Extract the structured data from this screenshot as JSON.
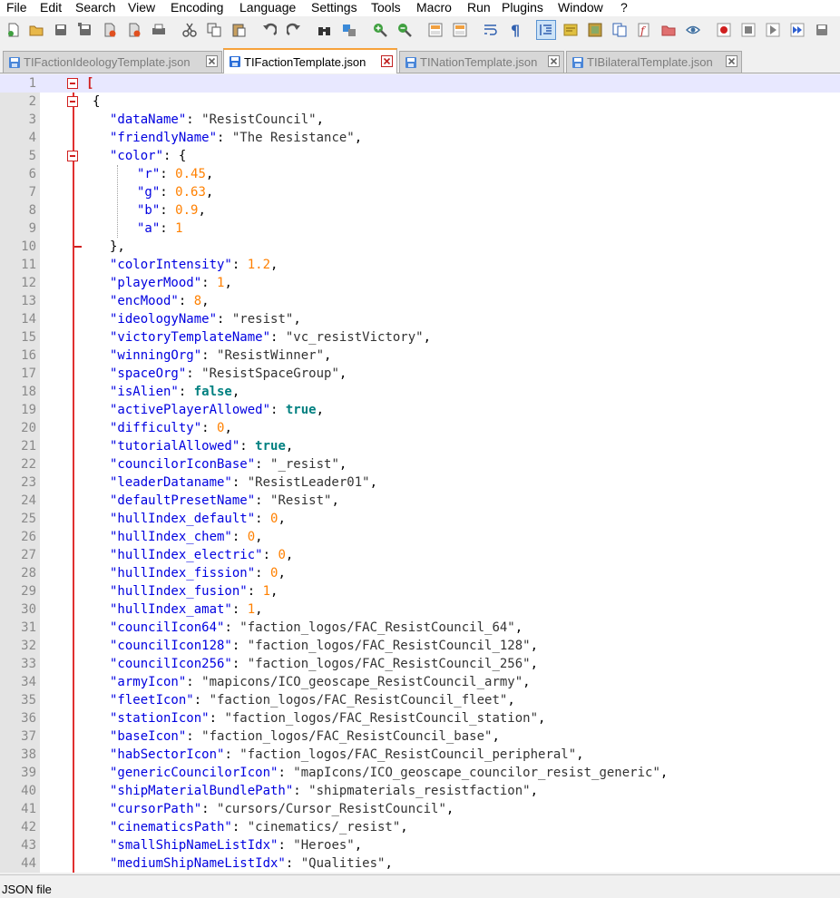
{
  "window": {
    "status_text": "JSON file"
  },
  "menu": [
    "File",
    "Edit",
    "Search",
    "View",
    "Encoding",
    "Language",
    "Settings",
    "Tools",
    "Macro",
    "Run",
    "Plugins",
    "Window",
    "?"
  ],
  "toolbar": {
    "buttons": [
      {
        "icon": "new-file-icon",
        "color": "#ffffff"
      },
      {
        "icon": "open-folder-icon",
        "color": "#e8b84a"
      },
      {
        "icon": "save-icon",
        "color": "#6a6a6a"
      },
      {
        "icon": "save-all-icon",
        "color": "#6a6a6a"
      },
      {
        "icon": "close-file-icon",
        "color": "#6a6a6a"
      },
      {
        "icon": "close-all-icon",
        "color": "#6a6a6a"
      },
      {
        "icon": "print-icon",
        "color": "#6a6a6a"
      },
      {
        "icon": "cut-icon",
        "color": "#555555"
      },
      {
        "icon": "copy-icon",
        "color": "#555555"
      },
      {
        "icon": "paste-icon",
        "color": "#555555"
      },
      {
        "icon": "undo-icon",
        "color": "#555555"
      },
      {
        "icon": "redo-icon",
        "color": "#555555"
      },
      {
        "icon": "find-icon",
        "color": "#333333"
      },
      {
        "icon": "replace-icon",
        "color": "#3b8ad8"
      },
      {
        "icon": "zoom-in-icon",
        "color": "#40a040"
      },
      {
        "icon": "zoom-out-icon",
        "color": "#40a040"
      },
      {
        "icon": "sync-vertical-icon",
        "color": "#f0a040"
      },
      {
        "icon": "sync-horizontal-icon",
        "color": "#f0a040"
      },
      {
        "icon": "word-wrap-icon",
        "color": "#3060b0"
      },
      {
        "icon": "show-all-characters-icon",
        "color": "#3060b0"
      },
      {
        "icon": "indent-guide-icon",
        "color": "#3060b0",
        "active": true
      },
      {
        "icon": "user-language-icon",
        "color": "#e0c040"
      },
      {
        "icon": "document-map-icon",
        "color": "#c0a040"
      },
      {
        "icon": "document-list-icon",
        "color": "#3060b0"
      },
      {
        "icon": "function-list-icon",
        "color": "#c03030"
      },
      {
        "icon": "folder-as-workspace-icon",
        "color": "#e07070"
      },
      {
        "icon": "monitoring-eye-icon",
        "color": "#4070a0"
      },
      {
        "icon": "record-macro-icon",
        "color": "#d02020"
      },
      {
        "icon": "stop-macro-icon",
        "color": "#808080"
      },
      {
        "icon": "play-macro-icon",
        "color": "#808080"
      },
      {
        "icon": "run-macro-multiple-icon",
        "color": "#3060d0"
      },
      {
        "icon": "save-macro-icon",
        "color": "#808080"
      }
    ]
  },
  "tabs": [
    {
      "label": "TIFactionIdeologyTemplate.json",
      "active": false
    },
    {
      "label": "TIFactionTemplate.json",
      "active": true
    },
    {
      "label": "TINationTemplate.json",
      "active": false
    },
    {
      "label": "TIBilateralTemplate.json",
      "active": false
    }
  ],
  "editor": {
    "current_line": 1,
    "lines": [
      {
        "n": "1",
        "indent": 0,
        "tokens": [
          [
            "bk",
            "["
          ]
        ]
      },
      {
        "n": "2",
        "indent": 1,
        "tokens": [
          [
            "p",
            "{"
          ]
        ]
      },
      {
        "n": "3",
        "indent": 2,
        "tokens": [
          [
            "k",
            "\"dataName\""
          ],
          [
            "p",
            ": "
          ],
          [
            "s",
            "\"ResistCouncil\""
          ],
          [
            "p",
            ","
          ]
        ]
      },
      {
        "n": "4",
        "indent": 2,
        "tokens": [
          [
            "k",
            "\"friendlyName\""
          ],
          [
            "p",
            ": "
          ],
          [
            "s",
            "\"The Resistance\""
          ],
          [
            "p",
            ","
          ]
        ]
      },
      {
        "n": "5",
        "indent": 2,
        "tokens": [
          [
            "k",
            "\"color\""
          ],
          [
            "p",
            ": {"
          ]
        ]
      },
      {
        "n": "6",
        "indent": 3,
        "tokens": [
          [
            "k",
            "\"r\""
          ],
          [
            "p",
            ": "
          ],
          [
            "n",
            "0.45"
          ],
          [
            "p",
            ","
          ]
        ]
      },
      {
        "n": "7",
        "indent": 3,
        "tokens": [
          [
            "k",
            "\"g\""
          ],
          [
            "p",
            ": "
          ],
          [
            "n",
            "0.63"
          ],
          [
            "p",
            ","
          ]
        ]
      },
      {
        "n": "8",
        "indent": 3,
        "tokens": [
          [
            "k",
            "\"b\""
          ],
          [
            "p",
            ": "
          ],
          [
            "n",
            "0.9"
          ],
          [
            "p",
            ","
          ]
        ]
      },
      {
        "n": "9",
        "indent": 3,
        "tokens": [
          [
            "k",
            "\"a\""
          ],
          [
            "p",
            ": "
          ],
          [
            "n",
            "1"
          ]
        ]
      },
      {
        "n": "10",
        "indent": 2,
        "tokens": [
          [
            "p",
            "},"
          ]
        ]
      },
      {
        "n": "11",
        "indent": 2,
        "tokens": [
          [
            "k",
            "\"colorIntensity\""
          ],
          [
            "p",
            ": "
          ],
          [
            "n",
            "1.2"
          ],
          [
            "p",
            ","
          ]
        ]
      },
      {
        "n": "12",
        "indent": 2,
        "tokens": [
          [
            "k",
            "\"playerMood\""
          ],
          [
            "p",
            ": "
          ],
          [
            "n",
            "1"
          ],
          [
            "p",
            ","
          ]
        ]
      },
      {
        "n": "13",
        "indent": 2,
        "tokens": [
          [
            "k",
            "\"encMood\""
          ],
          [
            "p",
            ": "
          ],
          [
            "n",
            "8"
          ],
          [
            "p",
            ","
          ]
        ]
      },
      {
        "n": "14",
        "indent": 2,
        "tokens": [
          [
            "k",
            "\"ideologyName\""
          ],
          [
            "p",
            ": "
          ],
          [
            "s",
            "\"resist\""
          ],
          [
            "p",
            ","
          ]
        ]
      },
      {
        "n": "15",
        "indent": 2,
        "tokens": [
          [
            "k",
            "\"victoryTemplateName\""
          ],
          [
            "p",
            ": "
          ],
          [
            "s",
            "\"vc_resistVictory\""
          ],
          [
            "p",
            ","
          ]
        ]
      },
      {
        "n": "16",
        "indent": 2,
        "tokens": [
          [
            "k",
            "\"winningOrg\""
          ],
          [
            "p",
            ": "
          ],
          [
            "s",
            "\"ResistWinner\""
          ],
          [
            "p",
            ","
          ]
        ]
      },
      {
        "n": "17",
        "indent": 2,
        "tokens": [
          [
            "k",
            "\"spaceOrg\""
          ],
          [
            "p",
            ": "
          ],
          [
            "s",
            "\"ResistSpaceGroup\""
          ],
          [
            "p",
            ","
          ]
        ]
      },
      {
        "n": "18",
        "indent": 2,
        "tokens": [
          [
            "k",
            "\"isAlien\""
          ],
          [
            "p",
            ": "
          ],
          [
            "b",
            "false"
          ],
          [
            "p",
            ","
          ]
        ]
      },
      {
        "n": "19",
        "indent": 2,
        "tokens": [
          [
            "k",
            "\"activePlayerAllowed\""
          ],
          [
            "p",
            ": "
          ],
          [
            "b",
            "true"
          ],
          [
            "p",
            ","
          ]
        ]
      },
      {
        "n": "20",
        "indent": 2,
        "tokens": [
          [
            "k",
            "\"difficulty\""
          ],
          [
            "p",
            ": "
          ],
          [
            "n",
            "0"
          ],
          [
            "p",
            ","
          ]
        ]
      },
      {
        "n": "21",
        "indent": 2,
        "tokens": [
          [
            "k",
            "\"tutorialAllowed\""
          ],
          [
            "p",
            ": "
          ],
          [
            "b",
            "true"
          ],
          [
            "p",
            ","
          ]
        ]
      },
      {
        "n": "22",
        "indent": 2,
        "tokens": [
          [
            "k",
            "\"councilorIconBase\""
          ],
          [
            "p",
            ": "
          ],
          [
            "s",
            "\"_resist\""
          ],
          [
            "p",
            ","
          ]
        ]
      },
      {
        "n": "23",
        "indent": 2,
        "tokens": [
          [
            "k",
            "\"leaderDataname\""
          ],
          [
            "p",
            ": "
          ],
          [
            "s",
            "\"ResistLeader01\""
          ],
          [
            "p",
            ","
          ]
        ]
      },
      {
        "n": "24",
        "indent": 2,
        "tokens": [
          [
            "k",
            "\"defaultPresetName\""
          ],
          [
            "p",
            ": "
          ],
          [
            "s",
            "\"Resist\""
          ],
          [
            "p",
            ","
          ]
        ]
      },
      {
        "n": "25",
        "indent": 2,
        "tokens": [
          [
            "k",
            "\"hullIndex_default\""
          ],
          [
            "p",
            ": "
          ],
          [
            "n",
            "0"
          ],
          [
            "p",
            ","
          ]
        ]
      },
      {
        "n": "26",
        "indent": 2,
        "tokens": [
          [
            "k",
            "\"hullIndex_chem\""
          ],
          [
            "p",
            ": "
          ],
          [
            "n",
            "0"
          ],
          [
            "p",
            ","
          ]
        ]
      },
      {
        "n": "27",
        "indent": 2,
        "tokens": [
          [
            "k",
            "\"hullIndex_electric\""
          ],
          [
            "p",
            ": "
          ],
          [
            "n",
            "0"
          ],
          [
            "p",
            ","
          ]
        ]
      },
      {
        "n": "28",
        "indent": 2,
        "tokens": [
          [
            "k",
            "\"hullIndex_fission\""
          ],
          [
            "p",
            ": "
          ],
          [
            "n",
            "0"
          ],
          [
            "p",
            ","
          ]
        ]
      },
      {
        "n": "29",
        "indent": 2,
        "tokens": [
          [
            "k",
            "\"hullIndex_fusion\""
          ],
          [
            "p",
            ": "
          ],
          [
            "n",
            "1"
          ],
          [
            "p",
            ","
          ]
        ]
      },
      {
        "n": "30",
        "indent": 2,
        "tokens": [
          [
            "k",
            "\"hullIndex_amat\""
          ],
          [
            "p",
            ": "
          ],
          [
            "n",
            "1"
          ],
          [
            "p",
            ","
          ]
        ]
      },
      {
        "n": "31",
        "indent": 2,
        "tokens": [
          [
            "k",
            "\"councilIcon64\""
          ],
          [
            "p",
            ": "
          ],
          [
            "s",
            "\"faction_logos/FAC_ResistCouncil_64\""
          ],
          [
            "p",
            ","
          ]
        ]
      },
      {
        "n": "32",
        "indent": 2,
        "tokens": [
          [
            "k",
            "\"councilIcon128\""
          ],
          [
            "p",
            ": "
          ],
          [
            "s",
            "\"faction_logos/FAC_ResistCouncil_128\""
          ],
          [
            "p",
            ","
          ]
        ]
      },
      {
        "n": "33",
        "indent": 2,
        "tokens": [
          [
            "k",
            "\"councilIcon256\""
          ],
          [
            "p",
            ": "
          ],
          [
            "s",
            "\"faction_logos/FAC_ResistCouncil_256\""
          ],
          [
            "p",
            ","
          ]
        ]
      },
      {
        "n": "34",
        "indent": 2,
        "tokens": [
          [
            "k",
            "\"armyIcon\""
          ],
          [
            "p",
            ": "
          ],
          [
            "s",
            "\"mapicons/ICO_geoscape_ResistCouncil_army\""
          ],
          [
            "p",
            ","
          ]
        ]
      },
      {
        "n": "35",
        "indent": 2,
        "tokens": [
          [
            "k",
            "\"fleetIcon\""
          ],
          [
            "p",
            ": "
          ],
          [
            "s",
            "\"faction_logos/FAC_ResistCouncil_fleet\""
          ],
          [
            "p",
            ","
          ]
        ]
      },
      {
        "n": "36",
        "indent": 2,
        "tokens": [
          [
            "k",
            "\"stationIcon\""
          ],
          [
            "p",
            ": "
          ],
          [
            "s",
            "\"faction_logos/FAC_ResistCouncil_station\""
          ],
          [
            "p",
            ","
          ]
        ]
      },
      {
        "n": "37",
        "indent": 2,
        "tokens": [
          [
            "k",
            "\"baseIcon\""
          ],
          [
            "p",
            ": "
          ],
          [
            "s",
            "\"faction_logos/FAC_ResistCouncil_base\""
          ],
          [
            "p",
            ","
          ]
        ]
      },
      {
        "n": "38",
        "indent": 2,
        "tokens": [
          [
            "k",
            "\"habSectorIcon\""
          ],
          [
            "p",
            ": "
          ],
          [
            "s",
            "\"faction_logos/FAC_ResistCouncil_peripheral\""
          ],
          [
            "p",
            ","
          ]
        ]
      },
      {
        "n": "39",
        "indent": 2,
        "tokens": [
          [
            "k",
            "\"genericCouncilorIcon\""
          ],
          [
            "p",
            ": "
          ],
          [
            "s",
            "\"mapIcons/ICO_geoscape_councilor_resist_generic\""
          ],
          [
            "p",
            ","
          ]
        ]
      },
      {
        "n": "40",
        "indent": 2,
        "tokens": [
          [
            "k",
            "\"shipMaterialBundlePath\""
          ],
          [
            "p",
            ": "
          ],
          [
            "s",
            "\"shipmaterials_resistfaction\""
          ],
          [
            "p",
            ","
          ]
        ]
      },
      {
        "n": "41",
        "indent": 2,
        "tokens": [
          [
            "k",
            "\"cursorPath\""
          ],
          [
            "p",
            ": "
          ],
          [
            "s",
            "\"cursors/Cursor_ResistCouncil\""
          ],
          [
            "p",
            ","
          ]
        ]
      },
      {
        "n": "42",
        "indent": 2,
        "tokens": [
          [
            "k",
            "\"cinematicsPath\""
          ],
          [
            "p",
            ": "
          ],
          [
            "s",
            "\"cinematics/_resist\""
          ],
          [
            "p",
            ","
          ]
        ]
      },
      {
        "n": "43",
        "indent": 2,
        "tokens": [
          [
            "k",
            "\"smallShipNameListIdx\""
          ],
          [
            "p",
            ": "
          ],
          [
            "s",
            "\"Heroes\""
          ],
          [
            "p",
            ","
          ]
        ]
      },
      {
        "n": "44",
        "indent": 2,
        "tokens": [
          [
            "k",
            "\"mediumShipNameListIdx\""
          ],
          [
            "p",
            ": "
          ],
          [
            "s",
            "\"Qualities\""
          ],
          [
            "p",
            ","
          ]
        ]
      }
    ]
  }
}
